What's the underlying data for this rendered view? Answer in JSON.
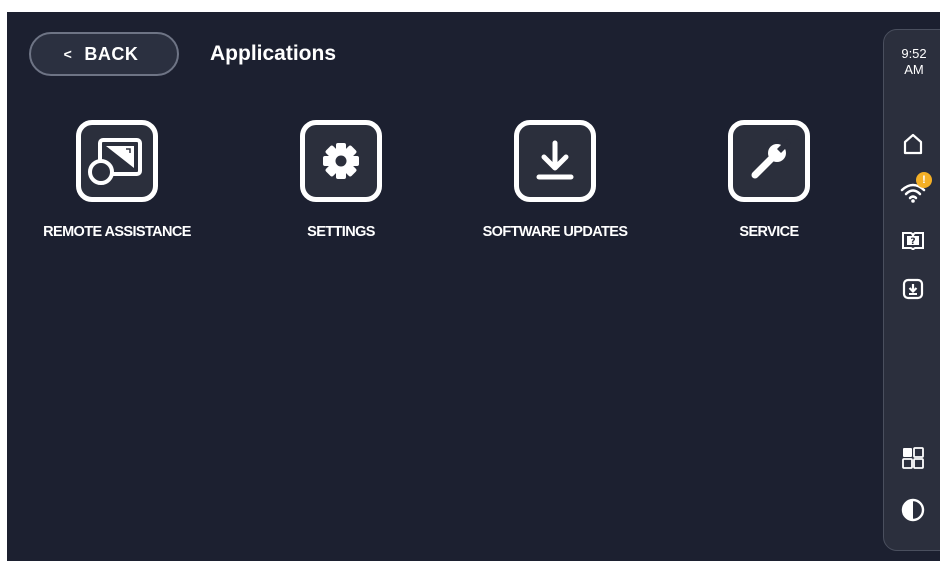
{
  "header": {
    "back_label": "BACK",
    "title": "Applications"
  },
  "apps": [
    {
      "label": "REMOTE ASSISTANCE",
      "icon": "remote-assistance-icon"
    },
    {
      "label": "SETTINGS",
      "icon": "gear-icon"
    },
    {
      "label": "SOFTWARE UPDATES",
      "icon": "download-icon"
    },
    {
      "label": "SERVICE",
      "icon": "wrench-icon"
    }
  ],
  "side_rail": {
    "time": "9:52",
    "meridiem": "AM",
    "wifi_badge": "!",
    "icons": [
      "home-icon",
      "wifi-icon",
      "help-book-icon",
      "download-icon",
      "grid-icon",
      "contrast-icon"
    ]
  },
  "colors": {
    "background": "#1c2030",
    "rail": "#2b2f3d",
    "badge": "#f5b026",
    "icon": "#ffffff"
  }
}
